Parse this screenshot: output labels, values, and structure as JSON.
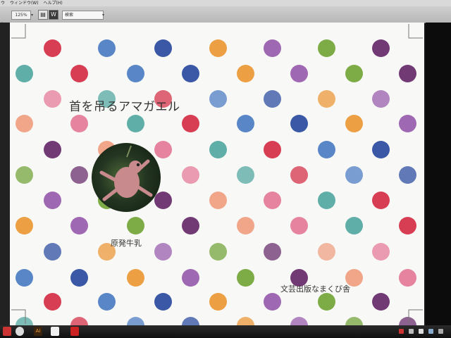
{
  "menubar": {
    "lead": "ウ",
    "items": [
      {
        "label": "ウィンドウ(W)"
      },
      {
        "label": "ヘルプ(H)"
      }
    ]
  },
  "toolbar": {
    "zoom_value": "125%",
    "search_value": "検索",
    "mode_label": "W"
  },
  "page": {
    "title": "首を吊るアマガエル",
    "author": "原発牛乳",
    "publisher": "文芸出版なまくび舎"
  },
  "taskbar": {
    "ai_label": "Ai"
  },
  "colors": {
    "red": "#d6344a",
    "orange": "#ec9a3a",
    "purple": "#6a2f6e",
    "teal": "#56aaa2",
    "navy": "#2f4fa1",
    "green": "#76a63c",
    "pink": "#e57c9a",
    "blue": "#4f7fc4",
    "lavender": "#9a60ae",
    "peach": "#f0a184"
  }
}
